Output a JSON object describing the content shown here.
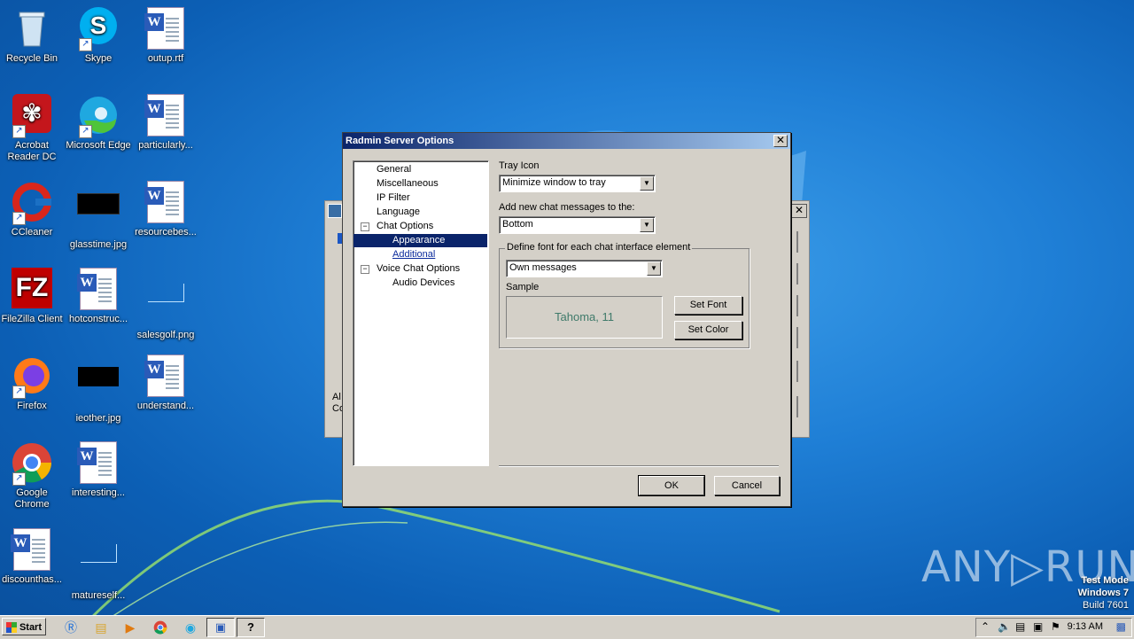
{
  "desktop": {
    "icons": [
      {
        "label": "Recycle Bin"
      },
      {
        "label": "Skype"
      },
      {
        "label": "outup.rtf"
      },
      {
        "label": "Acrobat Reader DC"
      },
      {
        "label": "Microsoft Edge"
      },
      {
        "label": "particularly..."
      },
      {
        "label": "CCleaner"
      },
      {
        "label": "glasstime.jpg"
      },
      {
        "label": "resourcebes..."
      },
      {
        "label": "FileZilla Client"
      },
      {
        "label": "hotconstruc..."
      },
      {
        "label": "salesgolf.png"
      },
      {
        "label": "Firefox"
      },
      {
        "label": "ieother.jpg"
      },
      {
        "label": "understand..."
      },
      {
        "label": "Google Chrome"
      },
      {
        "label": "interesting..."
      },
      {
        "label": "discounthas..."
      },
      {
        "label": "matureself..."
      }
    ]
  },
  "back_window": {
    "partial_text_1": "Al",
    "partial_text_2": "Co"
  },
  "dialog": {
    "title": "Radmin Server Options",
    "tree": [
      {
        "label": "General"
      },
      {
        "label": "Miscellaneous"
      },
      {
        "label": "IP Filter"
      },
      {
        "label": "Language"
      },
      {
        "label": "Chat Options"
      },
      {
        "label": "Appearance"
      },
      {
        "label": "Additional"
      },
      {
        "label": "Voice Chat Options"
      },
      {
        "label": "Audio Devices"
      }
    ],
    "tray_icon_label": "Tray Icon",
    "tray_icon_value": "Minimize window to tray",
    "add_messages_label": "Add new chat messages to the:",
    "add_messages_value": "Bottom",
    "font_group_label": "Define font for each chat interface element",
    "font_element_value": "Own messages",
    "sample_label": "Sample",
    "sample_text": "Tahoma, 11",
    "set_font_label": "Set Font",
    "set_color_label": "Set Color",
    "ok_label": "OK",
    "cancel_label": "Cancel"
  },
  "watermark": {
    "brand": "ANY▷RUN",
    "line1": "Test Mode",
    "line2": "Windows 7",
    "line3": "Build 7601"
  },
  "taskbar": {
    "start_label": "Start",
    "clock": "9:13 AM"
  }
}
